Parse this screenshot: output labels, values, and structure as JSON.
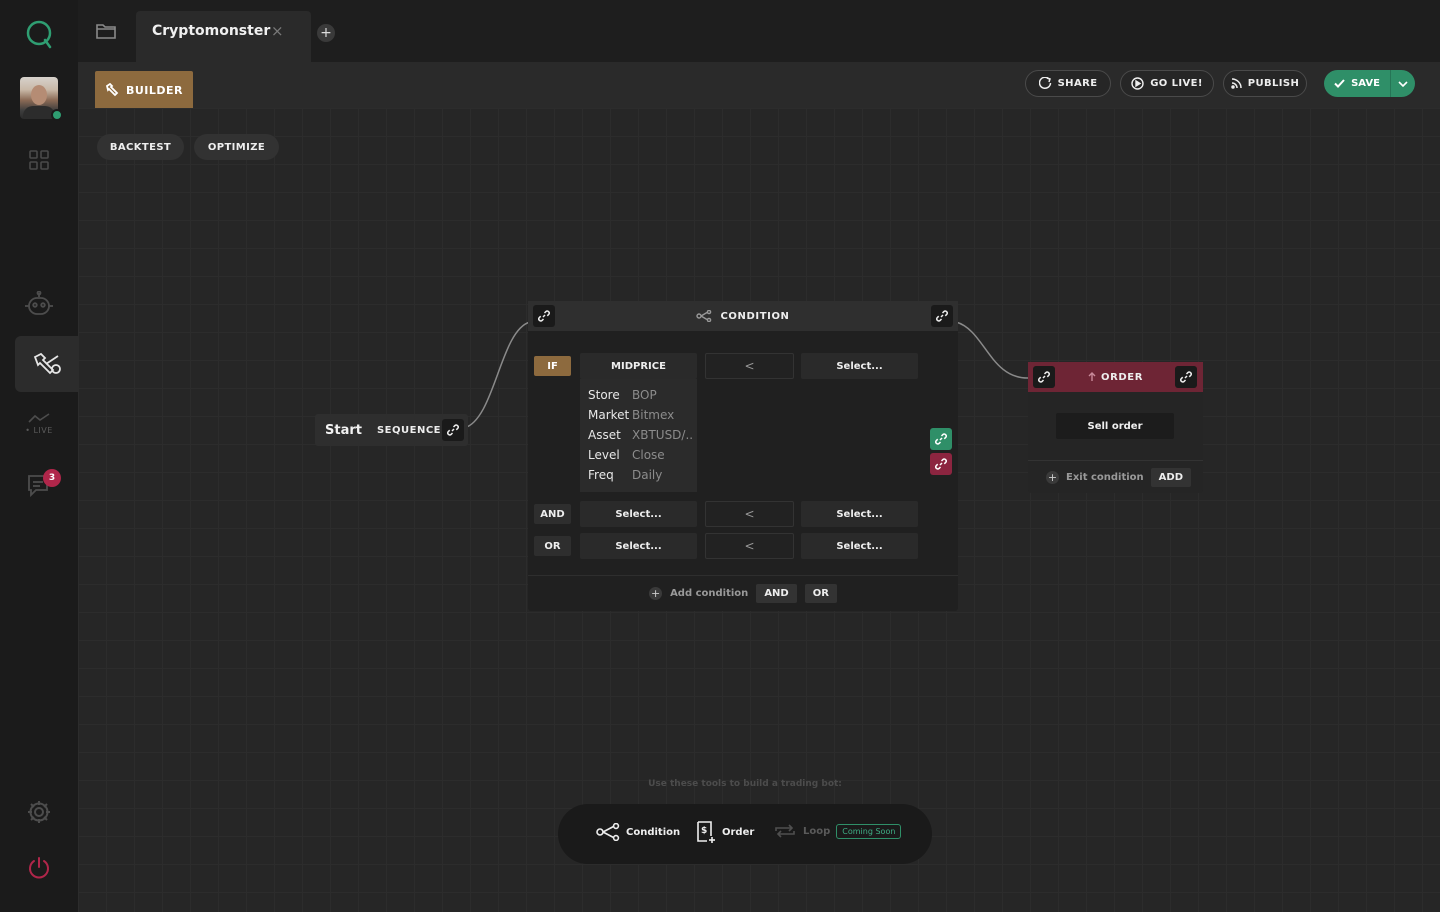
{
  "app": {
    "tab_title": "Cryptomonster",
    "tab_close": "×",
    "tab_add": "+"
  },
  "sidebar": {
    "live_label": "• LIVE",
    "chat_badge": "3"
  },
  "toolbar": {
    "builder_label": "BUILDER",
    "share_label": "SHARE",
    "golive_label": "GO LIVE!",
    "publish_label": "PUBLISH",
    "save_label": "SAVE"
  },
  "canvas": {
    "backtest_label": "BACKTEST",
    "optimize_label": "OPTIMIZE"
  },
  "start_node": {
    "label": "Start",
    "type": "SEQUENCE"
  },
  "condition_node": {
    "title": "CONDITION",
    "if_tag": "IF",
    "and_tag": "AND",
    "or_tag": "OR",
    "row1": {
      "left": "MIDPRICE",
      "op": "<",
      "right": "Select..."
    },
    "row2": {
      "left": "Select...",
      "op": "<",
      "right": "Select..."
    },
    "row3": {
      "left": "Select...",
      "op": "<",
      "right": "Select..."
    },
    "details": [
      {
        "key": "Store",
        "value": "BOP"
      },
      {
        "key": "Market",
        "value": "Bitmex"
      },
      {
        "key": "Asset",
        "value": "XBTUSD/..."
      },
      {
        "key": "Level",
        "value": "Close"
      },
      {
        "key": "Freq",
        "value": "Daily"
      }
    ],
    "add_condition_label": "Add condition",
    "add_and": "AND",
    "add_or": "OR"
  },
  "order_node": {
    "title": "ORDER",
    "sell_label": "Sell order",
    "exit_label": "Exit condition",
    "add_label": "ADD"
  },
  "tools": {
    "hint": "Use these tools to build a trading bot:",
    "condition_label": "Condition",
    "order_label": "Order",
    "loop_label": "Loop",
    "coming_soon": "Coming Soon"
  },
  "colors": {
    "accent_green": "#2f8f68",
    "builder_brown": "#8d6a3e",
    "order_red": "#6e2535",
    "danger_red": "#b0264a"
  }
}
